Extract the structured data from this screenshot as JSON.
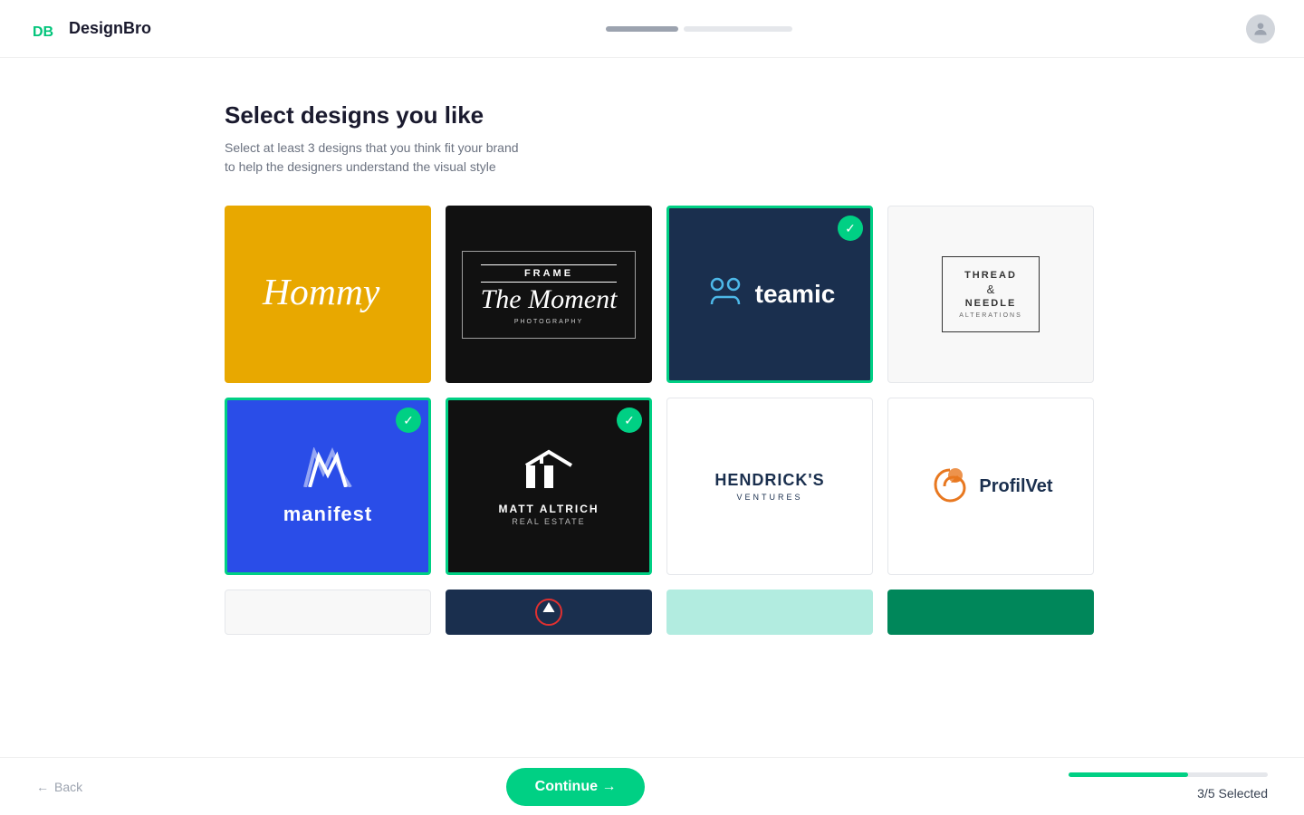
{
  "header": {
    "logo_text": "DesignBro",
    "logo_icon_letters": "DB"
  },
  "progress": {
    "segments": [
      {
        "type": "active"
      },
      {
        "type": "inactive"
      }
    ]
  },
  "page": {
    "title": "Select designs you like",
    "subtitle": "Select at least 3 designs that you think fit your brand\nto help the designers understand the visual style"
  },
  "designs": [
    {
      "id": "hommy",
      "selected": false,
      "alt": "Hommy logo"
    },
    {
      "id": "frame",
      "selected": false,
      "alt": "Frame The Moment Photography"
    },
    {
      "id": "teamic",
      "selected": true,
      "alt": "Teamic logo"
    },
    {
      "id": "thread",
      "selected": false,
      "alt": "Thread & Needle logo"
    },
    {
      "id": "manifest",
      "selected": true,
      "alt": "Manifest logo"
    },
    {
      "id": "matt",
      "selected": true,
      "alt": "Matt Altrich Real Estate"
    },
    {
      "id": "hendricks",
      "selected": false,
      "alt": "Hendrick's Ventures"
    },
    {
      "id": "profilvet",
      "selected": false,
      "alt": "ProfilVet logo"
    }
  ],
  "footer": {
    "back_label": "Back",
    "continue_label": "Continue →",
    "selected_text": "3/5 Selected"
  },
  "thread_needle": {
    "line1": "THREAD",
    "amp": "&",
    "line2": "NEEDLE",
    "sub": "ALTERATIONS"
  },
  "teamic": {
    "name": "teamic"
  },
  "manifest": {
    "name": "manifest"
  },
  "matt": {
    "name": "MATT ALTRICH",
    "sub": "REAL ESTATE"
  },
  "hendricks": {
    "name": "HENDRICK'S",
    "sub": "VENTURES"
  },
  "profilvet": {
    "name": "ProfilVet"
  }
}
